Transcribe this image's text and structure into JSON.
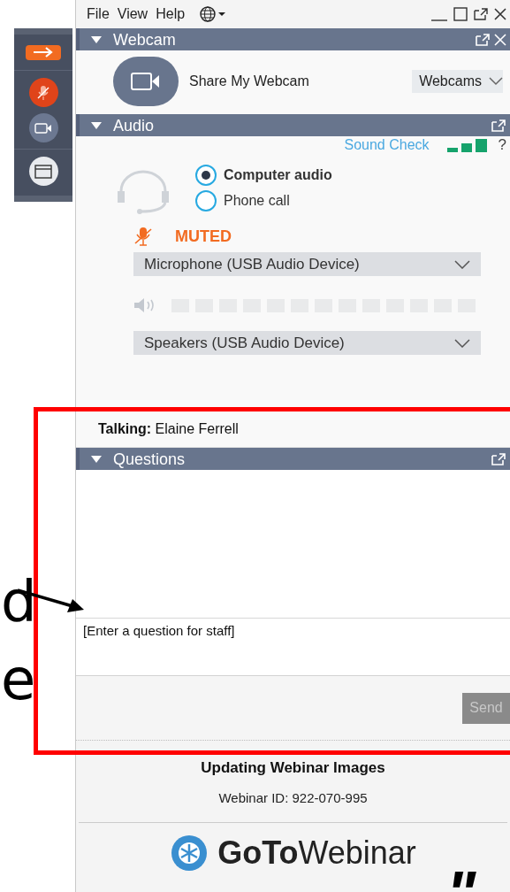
{
  "menu": [
    {
      "label": "File"
    },
    {
      "label": "View"
    },
    {
      "label": "Help"
    }
  ],
  "toolbar": {
    "mic_muted": true
  },
  "webcam": {
    "title": "Webcam",
    "expanded": true,
    "share_label": "Share My Webcam",
    "device": "Webcams"
  },
  "audio": {
    "title": "Audio",
    "expanded": true,
    "sound_check": "Sound Check",
    "help": "?",
    "options": [
      {
        "label": "Computer audio",
        "selected": true
      },
      {
        "label": "Phone call",
        "selected": false
      }
    ],
    "mic_status": "MUTED",
    "microphone": "Microphone (USB Audio Device)",
    "speakers": "Speakers (USB Audio Device)"
  },
  "talking": {
    "label": "Talking:",
    "name": "Elaine Ferrell"
  },
  "questions": {
    "title": "Questions",
    "expanded": true,
    "placeholder": "[Enter a question for staff]",
    "send": "Send"
  },
  "footer": {
    "title": "Updating Webinar Images",
    "webinar_id": "Webinar ID: 922-070-995",
    "brand_bold": "GoTo",
    "brand_light": "Webinar"
  },
  "annotations": [
    {
      "text": "d"
    },
    {
      "text": "e"
    },
    {
      "text": "\""
    }
  ]
}
